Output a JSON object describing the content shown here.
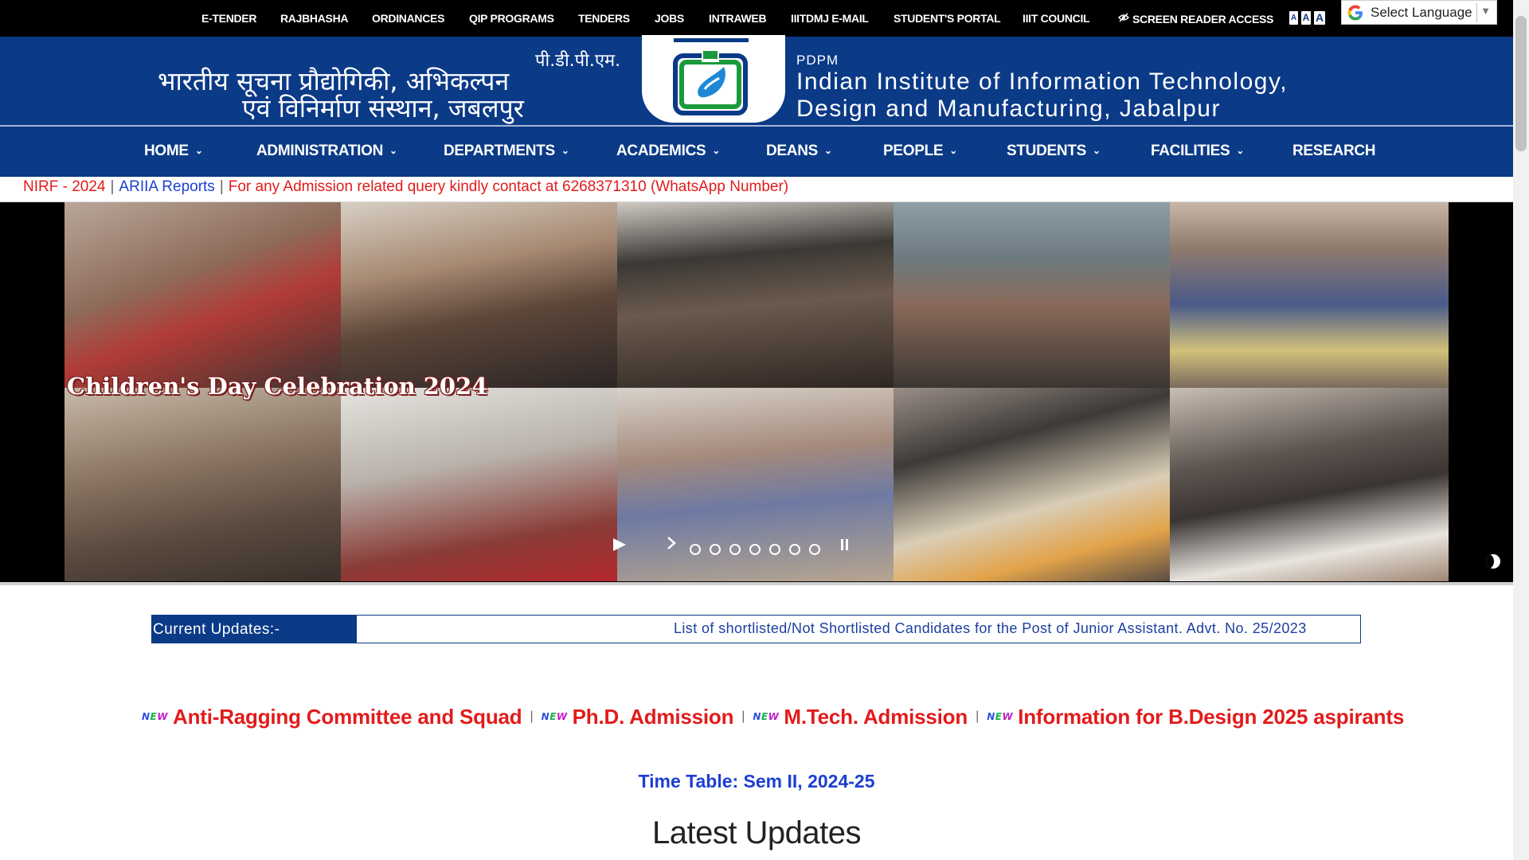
{
  "topbar": {
    "links": [
      "E-TENDER",
      "RAJBHASHA",
      "ORDINANCES",
      "QIP PROGRAMS",
      "TENDERS",
      "JOBS",
      "INTRAWEB",
      "IIITDMJ E-MAIL",
      "STUDENT'S PORTAL",
      "IIIT COUNCIL",
      "SCREEN READER ACCESS"
    ],
    "font_buttons": [
      "A",
      "A",
      "A"
    ],
    "language_select": "Select Language"
  },
  "header": {
    "hindi_abbr": "पी.डी.पी.एम.",
    "hindi_line1": "भारतीय सूचना प्रौद्योगिकी, अभिकल्पन",
    "hindi_line2": "एवं विनिर्माण संस्थान, जबलपुर",
    "english_abbr": "PDPM",
    "english_line1": "Indian Institute of Information Technology,",
    "english_line2": "Design and Manufacturing, Jabalpur",
    "brand_color": "#0b3a87"
  },
  "nav": {
    "items": [
      {
        "label": "HOME",
        "caret": true
      },
      {
        "label": "ADMINISTRATION",
        "caret": true
      },
      {
        "label": "DEPARTMENTS",
        "caret": true
      },
      {
        "label": "ACADEMICS",
        "caret": true
      },
      {
        "label": "DEANS",
        "caret": true
      },
      {
        "label": "PEOPLE",
        "caret": true
      },
      {
        "label": "STUDENTS",
        "caret": true
      },
      {
        "label": "FACILITIES",
        "caret": true
      },
      {
        "label": "RESEARCH",
        "caret": false
      }
    ]
  },
  "announcement": {
    "nirf": "NIRF - 2024",
    "ariia": "ARIIA Reports",
    "contact": "For any Admission related query kindly contact at 6268371310 (WhatsApp Number)",
    "separator": "|"
  },
  "slider": {
    "caption": "Children's Day Celebration 2024",
    "dot_count": 7,
    "current_slide": 1
  },
  "updates": {
    "label": "Current Updates:-",
    "text": "List of shortlisted/Not Shortlisted Candidates for the Post of Junior Assistant. Advt. No. 25/2023"
  },
  "new_links": {
    "badge": "NEW",
    "separator": "|",
    "items": [
      "Anti-Ragging Committee and Squad",
      "Ph.D. Admission",
      "M.Tech. Admission",
      "Information for B.Design 2025 aspirants"
    ]
  },
  "timetable": "Time Table: Sem II, 2024-25",
  "latest_updates_title": "Latest Updates"
}
